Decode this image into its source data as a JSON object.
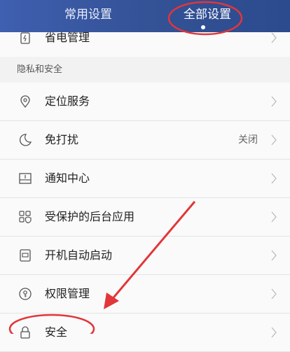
{
  "header": {
    "tabs": [
      {
        "label": "常用设置",
        "selected": false
      },
      {
        "label": "全部设置",
        "selected": true
      }
    ]
  },
  "section": {
    "title": "隐私和安全"
  },
  "rows": [
    {
      "label": "省电管理",
      "value": "",
      "icon": "battery-icon"
    },
    {
      "label": "定位服务",
      "value": "",
      "icon": "location-pin-icon"
    },
    {
      "label": "免打扰",
      "value": "关闭",
      "icon": "moon-icon"
    },
    {
      "label": "通知中心",
      "value": "",
      "icon": "notification-tray-icon"
    },
    {
      "label": "受保护的后台应用",
      "value": "",
      "icon": "protected-apps-icon"
    },
    {
      "label": "开机自动启动",
      "value": "",
      "icon": "autostart-icon"
    },
    {
      "label": "权限管理",
      "value": "",
      "icon": "key-icon"
    },
    {
      "label": "安全",
      "value": "",
      "icon": "lock-icon"
    }
  ],
  "annotation_color": "#e2363a"
}
